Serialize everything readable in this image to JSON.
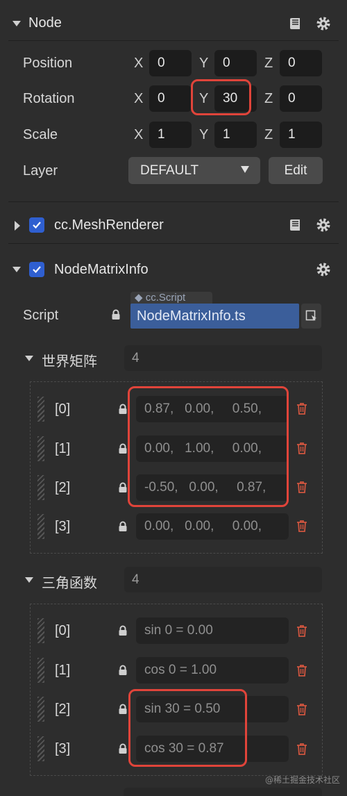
{
  "node": {
    "title": "Node",
    "position": {
      "label": "Position",
      "x": "0",
      "y": "0",
      "z": "0"
    },
    "rotation": {
      "label": "Rotation",
      "x": "0",
      "y": "30",
      "z": "0"
    },
    "scale": {
      "label": "Scale",
      "x": "1",
      "y": "1",
      "z": "1"
    },
    "layer": {
      "label": "Layer",
      "value": "DEFAULT",
      "edit": "Edit"
    },
    "axis_x": "X",
    "axis_y": "Y",
    "axis_z": "Z"
  },
  "mesh": {
    "title": "cc.MeshRenderer"
  },
  "matrix_info": {
    "title": "NodeMatrixInfo",
    "script_label": "Script",
    "script_tag": "◆ cc.Script",
    "script_value": "NodeMatrixInfo.ts"
  },
  "world_matrix": {
    "title": "世界矩阵",
    "count": "4",
    "rows": [
      {
        "index": "[0]",
        "value": "0.87,   0.00,     0.50,"
      },
      {
        "index": "[1]",
        "value": "0.00,   1.00,     0.00,"
      },
      {
        "index": "[2]",
        "value": "-0.50,   0.00,     0.87,"
      },
      {
        "index": "[3]",
        "value": "0.00,   0.00,     0.00,"
      }
    ]
  },
  "trig": {
    "title": "三角函数",
    "count": "4",
    "rows": [
      {
        "index": "[0]",
        "value": "sin 0 = 0.00"
      },
      {
        "index": "[1]",
        "value": "cos 0 = 1.00"
      },
      {
        "index": "[2]",
        "value": "sin 30 = 0.50"
      },
      {
        "index": "[3]",
        "value": "cos 30 = 0.87"
      }
    ]
  },
  "watermark": "@稀土掘金技术社区",
  "colors": {
    "bg": "#2d2d2d",
    "field": "#1c1c1c",
    "accent": "#2f5fd0",
    "highlight": "#e0443a",
    "delete": "#d0553f"
  },
  "icons": [
    "book-icon",
    "gear-icon",
    "lock-icon",
    "trash-icon",
    "file-picker-icon",
    "chevron-down-icon",
    "checkmark-icon"
  ]
}
